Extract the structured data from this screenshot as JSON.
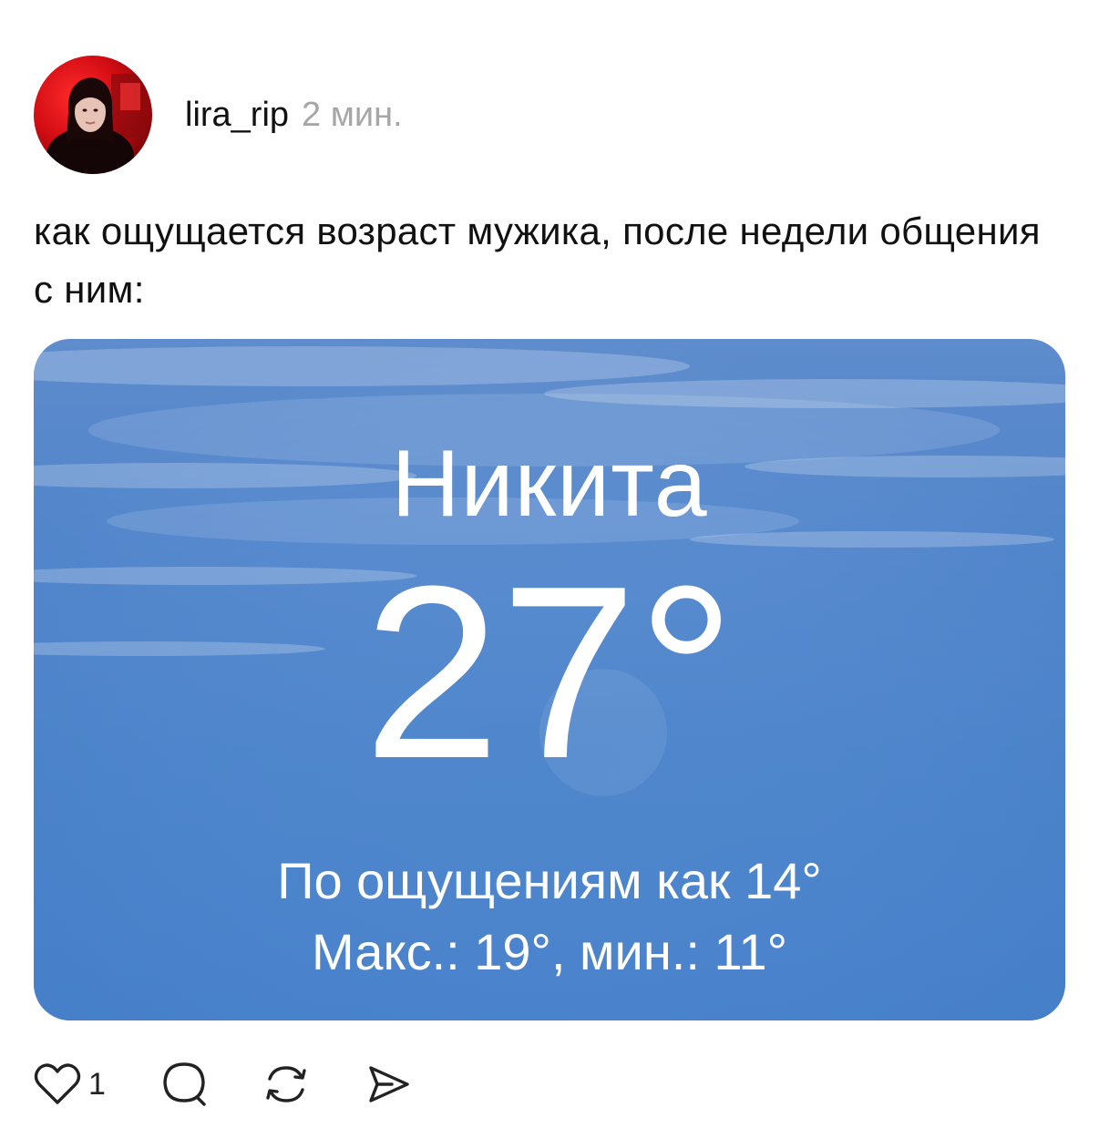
{
  "post": {
    "username": "lira_rip",
    "time": "2 мин.",
    "text": "как ощущается возраст мужика, после недели общения с ним:"
  },
  "weather_card": {
    "city": "Никита",
    "temperature": "27°",
    "feels_like": "По ощущениям как 14°",
    "max_min": "Макс.: 19°, мин.: 11°"
  },
  "actions": {
    "like_count": "1",
    "icons": [
      "heart-icon",
      "comment-icon",
      "repost-icon",
      "share-icon"
    ]
  },
  "colors": {
    "card_sky": "#4f86cc",
    "avatar_bg": "#d40e14",
    "time_gray": "#a6a6a6"
  }
}
